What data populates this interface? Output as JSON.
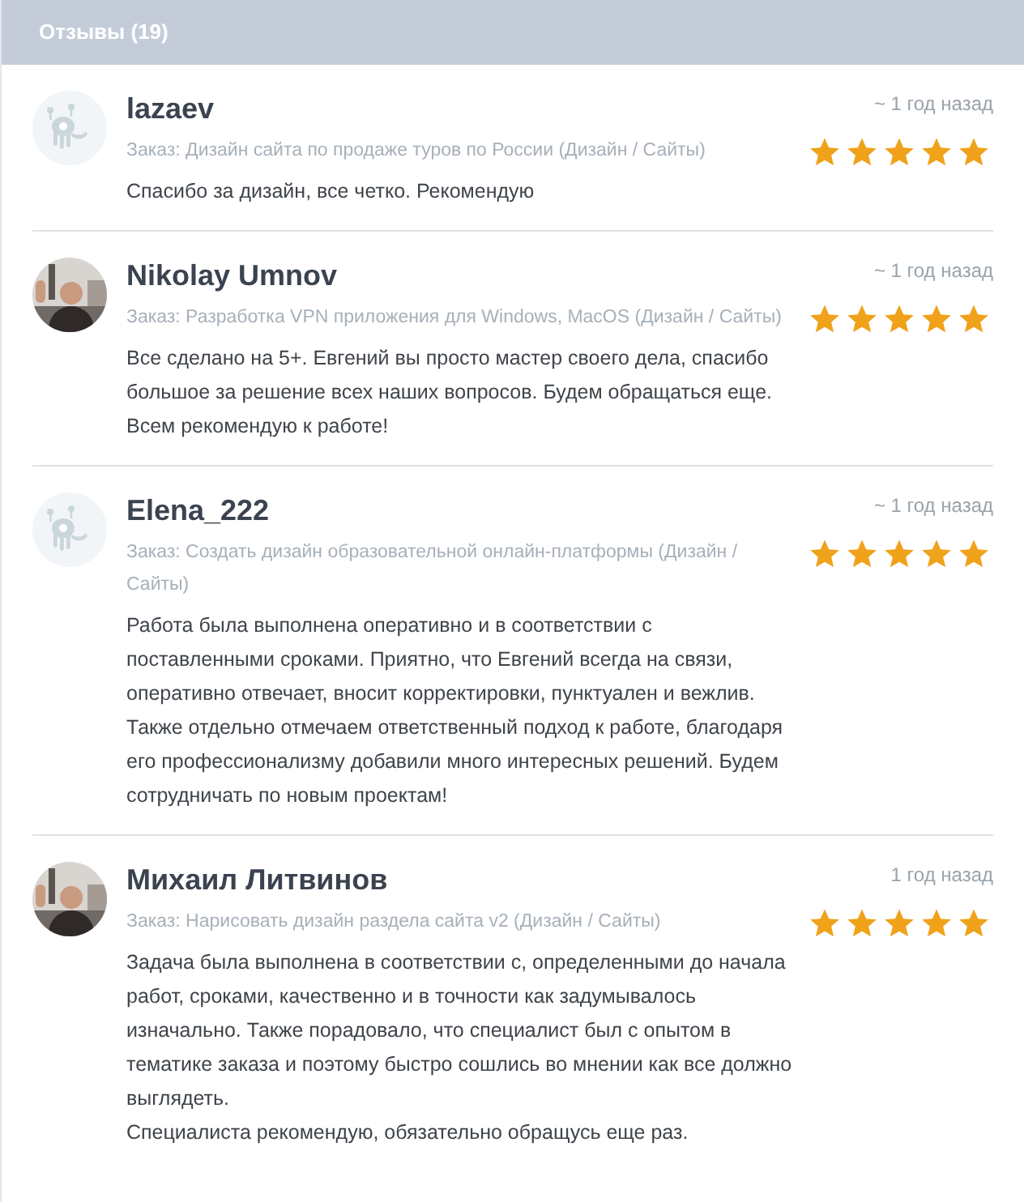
{
  "header": {
    "title": "Отзывы (19)"
  },
  "reviews": [
    {
      "kind": "default",
      "name": "lazaev",
      "time": "~ 1 год назад",
      "stars": 5,
      "order": "Заказ: Дизайн сайта по продаже туров по России (Дизайн / Сайты)",
      "text": "Спасибо за дизайн, все четко. Рекомендую"
    },
    {
      "kind": "picture",
      "name": "Nikolay Umnov",
      "time": "~ 1 год назад",
      "stars": 5,
      "order": "Заказ: Разработка VPN приложения для Windows, MacOS (Дизайн / Сайты)",
      "text": "Все сделано на 5+. Евгений вы просто мастер своего дела, спасибо большое за решение всех наших вопросов. Будем обращаться еще. Всем рекомендую к работе!"
    },
    {
      "kind": "default",
      "name": "Elena_222",
      "time": "~ 1 год назад",
      "stars": 5,
      "order": "Заказ: Создать дизайн образовательной онлайн-платформы (Дизайн / Сайты)",
      "text": "Работа была выполнена оперативно и в соответствии с поставленными сроками. Приятно, что Евгений всегда на связи, оперативно отвечает, вносит корректировки, пунктуален и вежлив.\nТакже отдельно отмечаем ответственный подход к работе, благодаря его профессионализму добавили много интересных решений. Будем сотрудничать по новым проектам!"
    },
    {
      "kind": "picture",
      "name": "Михаил Литвинов",
      "time": "1 год назад",
      "stars": 5,
      "order": "Заказ: Нарисовать дизайн раздела сайта v2 (Дизайн / Сайты)",
      "text": "Задача была выполнена в соответствии с, определенными до начала работ, сроками, качественно и в точности как задумывалось изначально. Также порадовало, что специалист был с опытом в тематике заказа и поэтому быстро сошлись во мнении как все должно выглядеть.\nСпециалиста рекомендую, обязательно обращусь еще раз."
    }
  ]
}
